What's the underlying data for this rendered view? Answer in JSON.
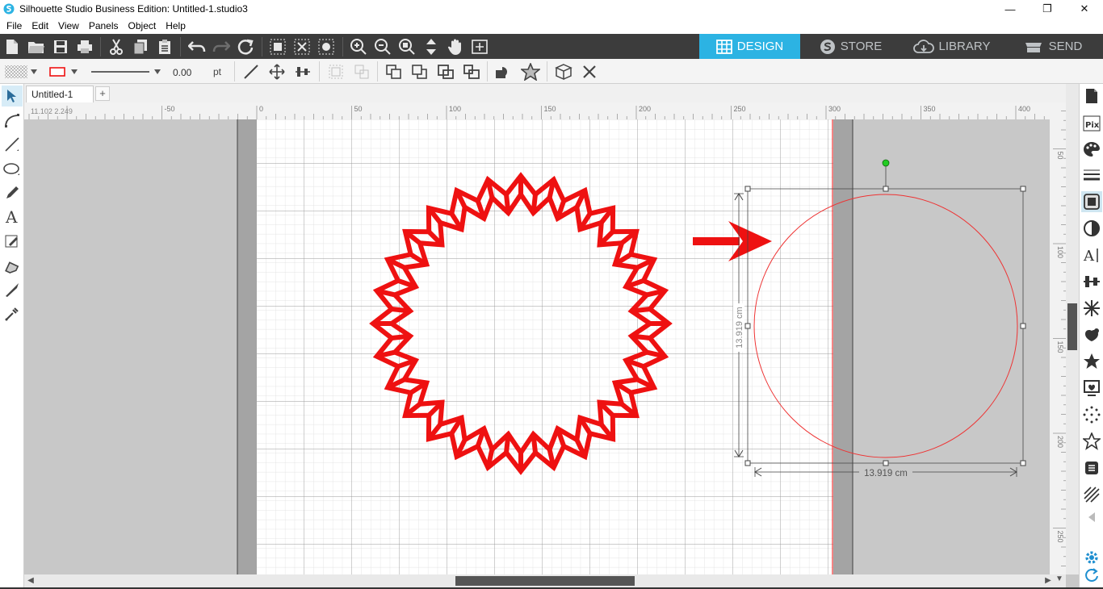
{
  "window": {
    "title": "Silhouette Studio Business Edition: Untitled-1.studio3",
    "minimize": "—",
    "restore": "❐",
    "close": "✕"
  },
  "menu": [
    "File",
    "Edit",
    "View",
    "Panels",
    "Object",
    "Help"
  ],
  "mode_tabs": [
    {
      "label": "DESIGN",
      "icon": "grid-icon",
      "active": true
    },
    {
      "label": "STORE",
      "icon": "silhouette-s-icon",
      "active": false
    },
    {
      "label": "LIBRARY",
      "icon": "cloud-icon",
      "active": false
    },
    {
      "label": "SEND",
      "icon": "cutter-icon",
      "active": false
    }
  ],
  "toolbar2": {
    "line_width": "0.00",
    "unit": "pt"
  },
  "document": {
    "tab_label": "Untitled-1",
    "add_tab": "+",
    "cursor_coords": "11.102   2.249"
  },
  "ruler": {
    "h_ticks": [
      "-50",
      "0",
      "50",
      "100",
      "150",
      "200",
      "250",
      "300",
      "350",
      "400"
    ],
    "v_ticks": [
      "50",
      "100",
      "150",
      "200",
      "250"
    ]
  },
  "selection": {
    "width_label": "13.919 cm",
    "height_label": "13.919 cm"
  },
  "colors": {
    "accent": "#2cb3e3",
    "shape_red": "#ee1111",
    "toolbar_dark": "#3c3c3c",
    "handle_green": "#22cc22"
  }
}
